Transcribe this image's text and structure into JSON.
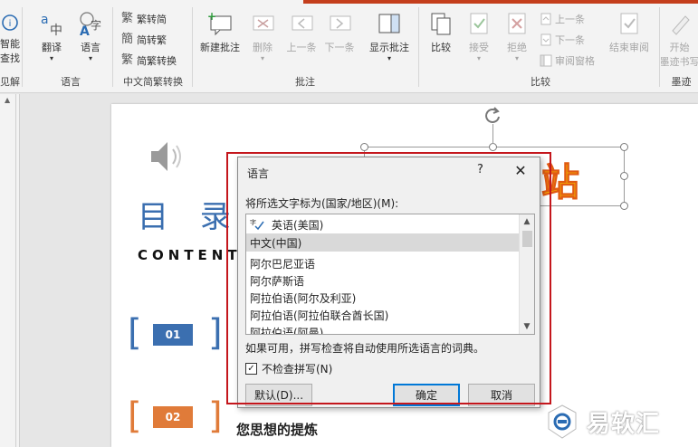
{
  "ribbon": {
    "partial_left_1": "智能",
    "partial_left_2": "查找",
    "partial_left_group": "见解",
    "translate": "翻译",
    "language": "语言",
    "group_language": "语言",
    "trad_to_simp": "繁转简",
    "simp_to_trad": "简转繁",
    "simp_trad_convert": "简繁转换",
    "group_chinese": "中文简繁转换",
    "new_comment": "新建批注",
    "delete": "删除",
    "previous": "上一条",
    "next": "下一条",
    "show_comments": "显示批注",
    "group_comments": "批注",
    "compare": "比较",
    "accept": "接受",
    "reject": "拒绝",
    "prev_change": "上一条",
    "next_change": "下一条",
    "reviewing_pane": "审阅窗格",
    "end_review": "结束审阅",
    "group_compare": "比较",
    "start_ink": "开始",
    "start_ink_2": "墨迹书写",
    "group_ink": "墨迹"
  },
  "slide": {
    "title": "目 录",
    "subtitle": "CONTENTS",
    "item1_num": "01",
    "item2_num": "02",
    "item2_text": "您思想的提炼",
    "big_text": "站"
  },
  "dialog": {
    "title": "语言",
    "help": "?",
    "close": "✕",
    "prompt": "将所选文字标为(国家/地区)(M):",
    "languages": [
      "英语(美国)",
      "中文(中国)",
      "阿尔巴尼亚语",
      "阿尔萨斯语",
      "阿拉伯语(阿尔及利亚)",
      "阿拉伯语(阿拉伯联合酋长国)",
      "阿拉伯语(阿曼)"
    ],
    "selected_index": 1,
    "note": "如果可用，拼写检查将自动使用所选语言的词典。",
    "checkbox_label": "不检查拼写(N)",
    "checkbox_checked": true,
    "btn_default": "默认(D)...",
    "btn_ok": "确定",
    "btn_cancel": "取消"
  },
  "watermark": {
    "text": "易软汇"
  },
  "colors": {
    "accent": "#c43e1c",
    "slide_blue": "#3b6fb0",
    "slide_orange": "#e07b39",
    "highlight_frame": "#c4161c"
  }
}
